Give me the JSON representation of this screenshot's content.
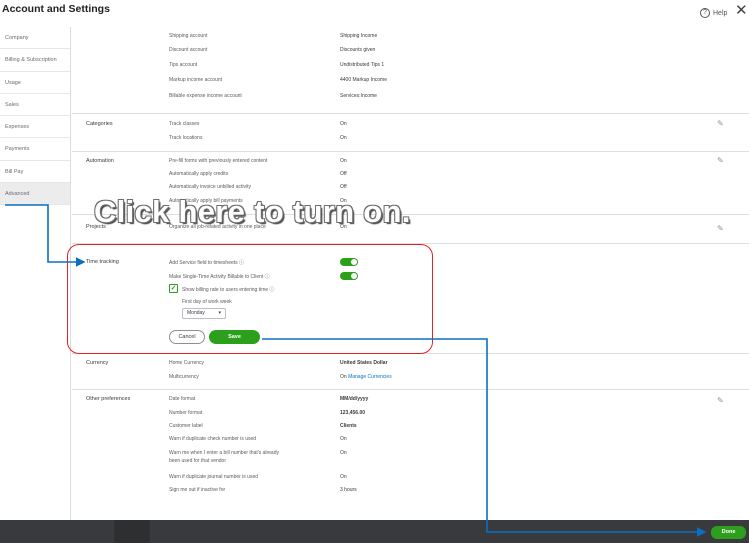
{
  "header": {
    "title": "Account and Settings",
    "help_label": "Help",
    "help_icon": "?",
    "close_icon": "✕"
  },
  "sidebar": {
    "items": [
      {
        "label": "Company"
      },
      {
        "label": "Billing & Subscription"
      },
      {
        "label": "Usage"
      },
      {
        "label": "Sales"
      },
      {
        "label": "Expenses"
      },
      {
        "label": "Payments"
      },
      {
        "label": "Bill Pay"
      },
      {
        "label": "Advanced"
      }
    ],
    "active": "Advanced"
  },
  "chart_of_accounts": {
    "rows": [
      {
        "label": "Shipping account",
        "value": "Shipping Income"
      },
      {
        "label": "Discount account",
        "value": "Discounts given"
      },
      {
        "label": "Tips account",
        "value": "Undistributed Tips 1"
      },
      {
        "label": "Markup income account",
        "value": "4400 Markup Income"
      },
      {
        "label": "Billable expense income account",
        "value": "Services:Income"
      }
    ]
  },
  "categories": {
    "title": "Categories",
    "rows": [
      {
        "label": "Track classes",
        "value": "On"
      },
      {
        "label": "Track locations",
        "value": "On"
      }
    ]
  },
  "automation": {
    "title": "Automation",
    "rows": [
      {
        "label": "Pre-fill forms with previously entered content",
        "value": "On"
      },
      {
        "label": "Automatically apply credits",
        "value": "Off"
      },
      {
        "label": "Automatically invoice unbilled activity",
        "value": "Off"
      },
      {
        "label": "Automatically apply bill payments",
        "value": "On"
      }
    ]
  },
  "projects": {
    "title": "Projects",
    "rows": [
      {
        "label": "Organize all job-related activity in one place",
        "value": "On"
      }
    ]
  },
  "time_tracking": {
    "title": "Time tracking",
    "add_service_label": "Add Service field to timesheets ⓘ",
    "add_service_on": true,
    "billable_label": "Make Single-Time Activity Billable to Client ⓘ",
    "billable_on": true,
    "show_rate_label": "Show billing rate to users entering time ⓘ",
    "show_rate_checked": true,
    "check_mark": "✓",
    "first_day_label": "First day of work week",
    "first_day_value": "Monday",
    "caret": "▾",
    "cancel_label": "Cancel",
    "save_label": "Save"
  },
  "currency": {
    "title": "Currency",
    "rows": [
      {
        "label": "Home Currency",
        "value": "United States Dollar"
      },
      {
        "label": "Multicurrency",
        "value": "On",
        "link": "Manage Currencies"
      }
    ]
  },
  "other_preferences": {
    "title": "Other preferences",
    "rows": [
      {
        "label": "Date format",
        "value": "MM/dd/yyyy"
      },
      {
        "label": "Number format",
        "value": "123,456.00"
      },
      {
        "label": "Customer label",
        "value": "Clients"
      },
      {
        "label": "Warn if duplicate check number is used",
        "value": "On"
      },
      {
        "label": "Warn me when I enter a bill number that's already",
        "label2": "been used for that vendor",
        "value": "On"
      },
      {
        "label": "Warn if duplicate journal number is used",
        "value": "On"
      },
      {
        "label": "Sign me out if inactive for",
        "value": "3 hours"
      }
    ]
  },
  "annotation": {
    "text": "Click here to turn on."
  },
  "footer": {
    "done_label": "Done"
  },
  "colors": {
    "accent": "#2ca01c",
    "annotation_box": "#e12424",
    "arrow": "#0a6fc2",
    "footer": "#393a3d"
  },
  "icons": {
    "edit": "pencil-icon",
    "close": "close-icon",
    "help": "help-icon"
  }
}
